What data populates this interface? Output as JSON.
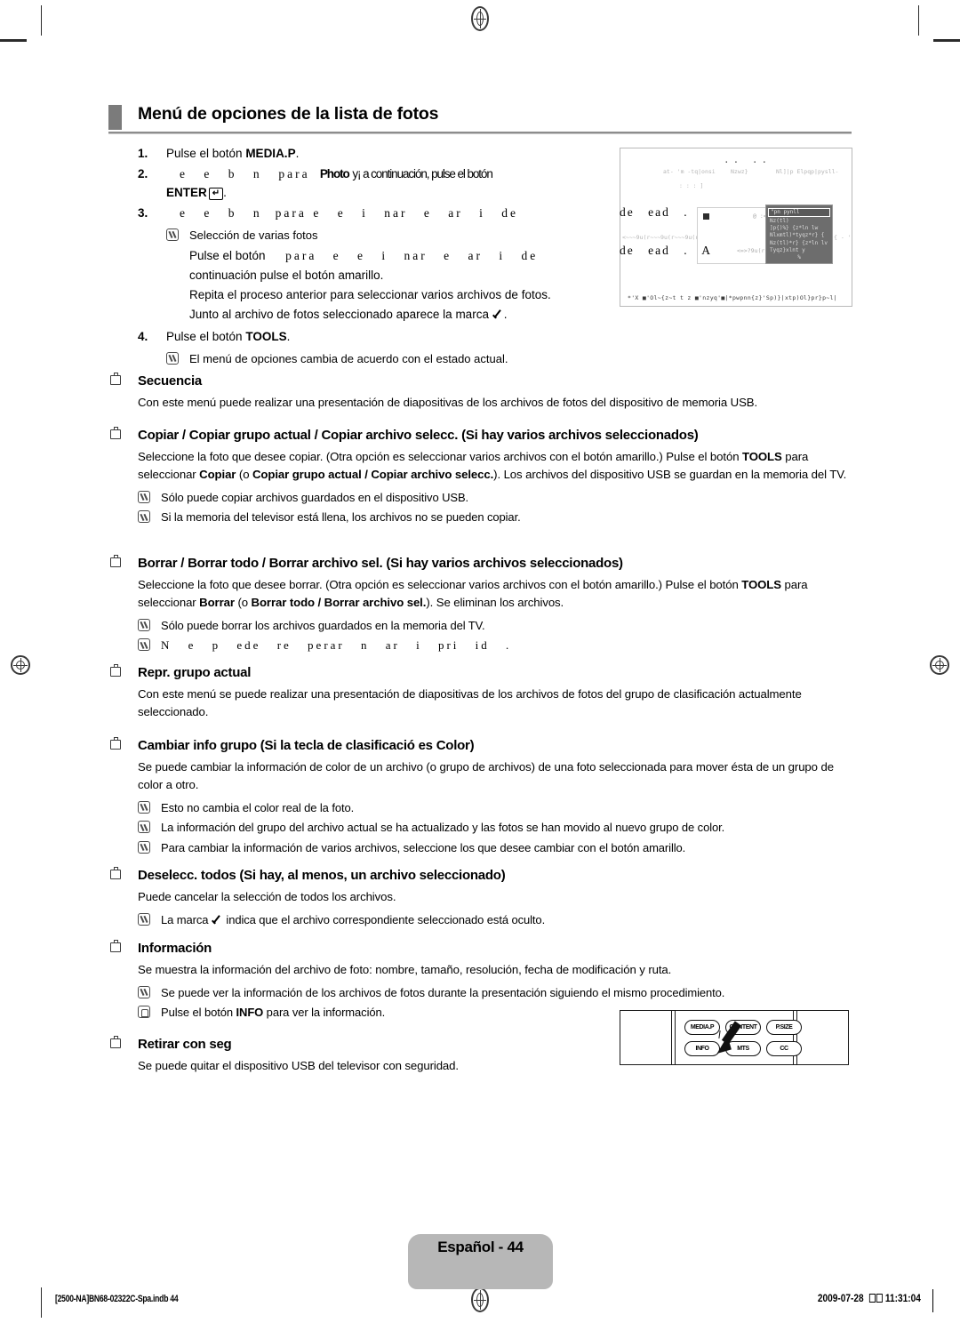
{
  "section": {
    "title": "Menú de opciones de la lista de fotos"
  },
  "steps": [
    {
      "num": "1.",
      "text_before": "Pulse el botón ",
      "bold": "MEDIA.P",
      "text_after": "."
    },
    {
      "num": "2.",
      "gap1": "e e    b        n",
      "mid": "para",
      "bold1": "Photo",
      "gap2": "y¡ a continuación, pulse el botón",
      "line2_bold": "ENTER",
      "line2_key": "↵",
      "line2_after": "."
    },
    {
      "num": "3.",
      "gap1": "e e    b        n",
      "mid": "para",
      "gap2": "e e    i   nar e   ar    i      de"
    }
  ],
  "multi_select": {
    "note_label": "Selección de varias fotos",
    "line1_before": "Pulse el botón",
    "line1_gap": "para    e  e     i   nar e    ar     i        de",
    "line2": "continuación pulse el botón amarillo.",
    "line3": "Repita el proceso anterior para seleccionar varios archivos de fotos.",
    "line4_before": "Junto al archivo de fotos seleccionado aparece la marca",
    "line4_after": "."
  },
  "step4": {
    "num": "4.",
    "text_before": "Pulse el botón ",
    "bold": "TOOLS",
    "text_after": ".",
    "note": "El menú de opciones cambia de acuerdo con el estado actual."
  },
  "figure_tv": {
    "caption_a": "de    ead    .",
    "caption_b": "de    ead    . A",
    "dots": ".. ..",
    "blur_top_1": "at- 'm -tq|onsi",
    "blur_top_2": "Nzwz}",
    "blur_top_3": "Nl]|p Elpqp|pysll-",
    "blur_top_4": ":   :   :        ]",
    "panel_label": "@ :<@",
    "panel_sub": "<=>?9u(r",
    "blur_left": "<~~~9u(r~~~9u(r~~~9u(r",
    "blur_right": "{ - ' '  9u|r",
    "menu_selected": "\"pn pynll",
    "menu_items": [
      "Nz(tl)",
      "]p{)%} {z*ln  lw",
      "Nlxmtl)*tyqz*r} {",
      "Nz(tl)*r} {z*ln  lv",
      "Tyqz}xlnt y"
    ],
    "menu_pct": "%",
    "bottom_strip": "*'X  ■'Ol~{z~t t z ■'nzyq'■|*pwpnn{z}'Sp)}|xtp)Ol}pr}p~l|"
  },
  "options": [
    {
      "head": "Secuencia",
      "paragraphs": [
        "Con este menú puede realizar una presentación de diapositivas de los archivos de fotos del dispositivo de memoria USB."
      ],
      "notes": []
    },
    {
      "head": "Copiar / Copiar grupo actual / Copiar archivo selecc. (Si hay varios archivos seleccionados)",
      "paragraph_runs": [
        {
          "t": "Seleccione la foto que desee copiar. (Otra opción es seleccionar varios archivos con el botón amarillo.) Pulse el botón ",
          "b": false
        },
        {
          "t": "TOOLS",
          "b": true
        },
        {
          "t": " para seleccionar ",
          "b": false
        },
        {
          "t": "Copiar",
          "b": true
        },
        {
          "t": " (o ",
          "b": false
        },
        {
          "t": "Copiar grupo actual / Copiar archivo selecc.",
          "b": true
        },
        {
          "t": "). Los archivos del dispositivo USB se guardan en la memoria del TV.",
          "b": false
        }
      ],
      "notes": [
        "Sólo puede copiar archivos guardados en el dispositivo USB.",
        "Si la memoria del televisor está llena, los archivos no se pueden copiar."
      ]
    },
    {
      "head": "Borrar / Borrar todo / Borrar archivo sel. (Si hay varios archivos seleccionados)",
      "paragraph_runs": [
        {
          "t": "Seleccione la foto que desee borrar. (Otra opción es seleccionar varios archivos con el botón amarillo.) Pulse el botón ",
          "b": false
        },
        {
          "t": "TOOLS",
          "b": true
        },
        {
          "t": " para seleccionar ",
          "b": false
        },
        {
          "t": "Borrar",
          "b": true
        },
        {
          "t": " (o ",
          "b": false
        },
        {
          "t": "Borrar todo / Borrar archivo sel.",
          "b": true
        },
        {
          "t": "). Se eliminan los archivos.",
          "b": false
        }
      ],
      "notes": [
        "Sólo puede borrar los archivos guardados en la memoria del TV."
      ],
      "note_gap": "N      e p   ede re    perar   n ar    i             pri   id  ."
    },
    {
      "head": "Repr. grupo actual",
      "paragraphs": [
        "Con este menú se puede realizar una presentación de diapositivas de los archivos de fotos del grupo de clasificación actualmente seleccionado."
      ],
      "notes": []
    },
    {
      "head": "Cambiar info grupo (Si la tecla de clasificació es  Color)",
      "paragraphs": [
        "Se puede cambiar la información de color de un archivo (o grupo de archivos) de una foto seleccionada para mover ésta de un grupo de color a otro."
      ],
      "notes": [
        "Esto no cambia el color real de la foto.",
        "La información del grupo del archivo actual se ha actualizado y las fotos se han movido al nuevo grupo de color.",
        "Para cambiar la información de varios archivos, seleccione los que desee cambiar con el botón amarillo."
      ]
    },
    {
      "head": "Deselecc. todos (Si hay, al menos, un archivo seleccionado)",
      "paragraphs": [
        "Puede cancelar la selección de todos los archivos."
      ],
      "note_check_before": "La marca",
      "note_check_after": "indica que el archivo correspondiente seleccionado está oculto."
    },
    {
      "head": "Información",
      "paragraphs": [
        "Se muestra la información del archivo de foto: nombre, tamaño, resolución, fecha de modificación y ruta."
      ],
      "notes": [
        "Se puede ver la información de los archivos de fotos durante la presentación siguiendo el mismo procedimiento."
      ],
      "hand_note_runs": [
        {
          "t": "Pulse el botón ",
          "b": false
        },
        {
          "t": "INFO",
          "b": true
        },
        {
          "t": " para ver la información.",
          "b": false
        }
      ]
    },
    {
      "head": "Retirar con seg",
      "paragraphs": [
        "Se puede quitar el dispositivo USB del televisor con seguridad."
      ],
      "notes": []
    }
  ],
  "remote": {
    "buttons": [
      {
        "label": "MEDIA.P"
      },
      {
        "label": "CONTENT"
      },
      {
        "label": "P.SIZE"
      },
      {
        "label": "INFO"
      },
      {
        "label": "MTS"
      },
      {
        "label": "CC"
      }
    ]
  },
  "footer": {
    "page_badge": "Español - 44",
    "left_code": "[2500-NA]BN68-02322C-Spa.indb  44",
    "date": "2009-07-28",
    "time": "11:31:04"
  },
  "colors": {
    "title_tab": "#7b7b7b",
    "title_rule": "#8d8d8d",
    "badge_bg": "#b7b7b7",
    "tv_menu_bg": "#6d6d6d"
  }
}
